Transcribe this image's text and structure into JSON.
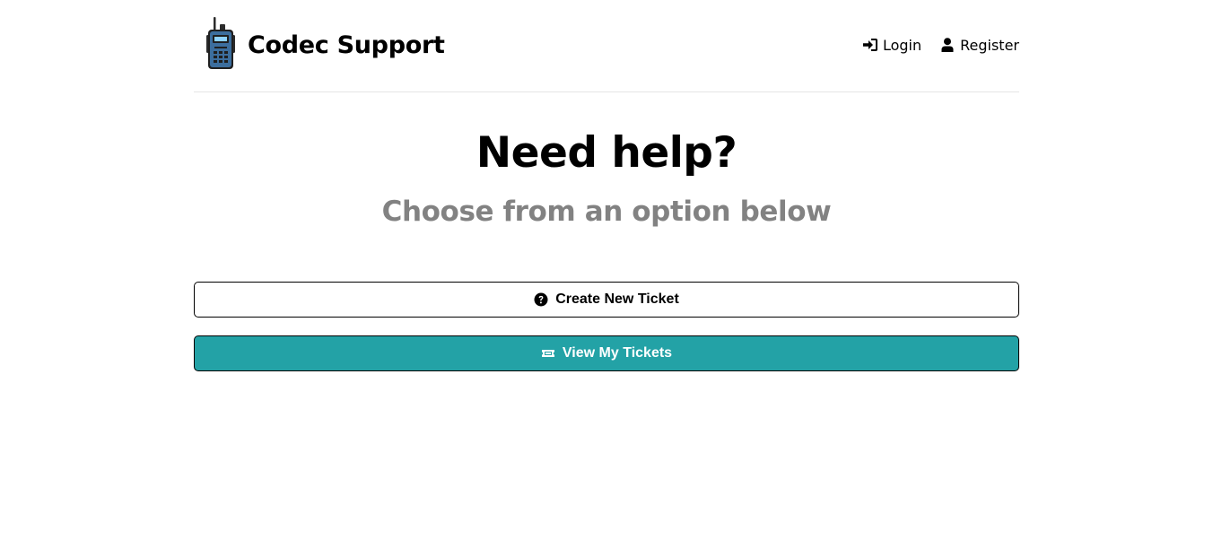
{
  "header": {
    "logo": {
      "text": "Codec Support",
      "icon": "walkie-talkie-icon"
    },
    "nav": [
      {
        "label": "Login",
        "icon": "sign-in-icon"
      },
      {
        "label": "Register",
        "icon": "user-icon"
      }
    ]
  },
  "main": {
    "title": "Need help?",
    "subtitle": "Choose from an option below",
    "buttons": [
      {
        "label": "Create New Ticket",
        "icon": "question-circle-icon"
      },
      {
        "label": "View My Tickets",
        "icon": "ticket-icon"
      }
    ]
  },
  "colors": {
    "accent": "#23a2a6",
    "subtitle": "#828282",
    "divider": "#e6e6e6"
  }
}
